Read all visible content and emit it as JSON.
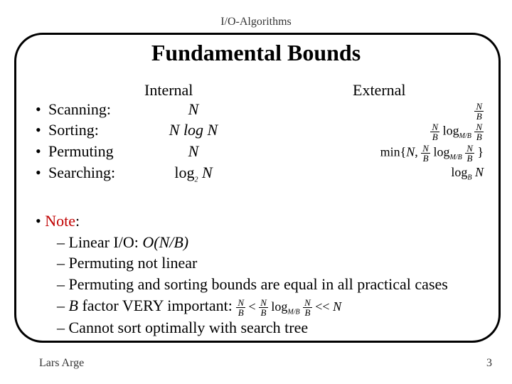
{
  "header": "I/O-Algorithms",
  "title": "Fundamental Bounds",
  "columns": {
    "internal": "Internal",
    "external": "External"
  },
  "rows": {
    "scanning": {
      "label": "Scanning:",
      "internal": "N",
      "external_html": "frac_NB"
    },
    "sorting": {
      "label": "Sorting:",
      "internal": "N log N",
      "external_html": "sort"
    },
    "permuting": {
      "label": "Permuting",
      "internal": "N",
      "external_html": "perm"
    },
    "searching": {
      "label": "Searching:",
      "internal_html": "log2N",
      "external_html": "logBN"
    }
  },
  "note": {
    "title": "Note",
    "l1_pre": "Linear I/O: ",
    "l1_math": "O(N/B)",
    "l2": "Permuting not linear",
    "l3": "Permuting and sorting bounds are equal in all practical cases",
    "l4_pre_a": "",
    "l4_b": "B",
    "l4_post": " factor VERY important:  ",
    "l5": "Cannot sort optimally with search tree"
  },
  "footer": {
    "left": "Lars Arge",
    "right": "3"
  },
  "bullet": "•",
  "dash": "–"
}
